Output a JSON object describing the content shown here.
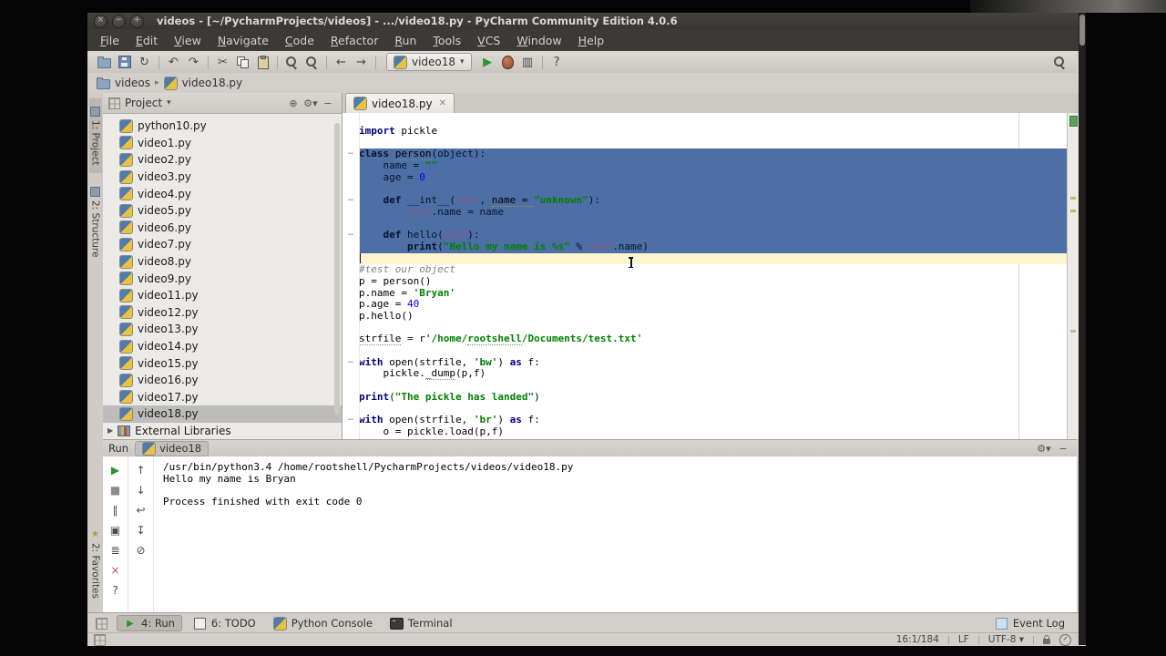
{
  "titlebar": {
    "title": "videos - [~/PycharmProjects/videos] - .../video18.py - PyCharm Community Edition 4.0.6",
    "buttons": [
      {
        "name": "close-button",
        "glyph": "×"
      },
      {
        "name": "minimize-button",
        "glyph": "−"
      },
      {
        "name": "maximize-button",
        "glyph": "+"
      }
    ]
  },
  "menubar": {
    "items": [
      "File",
      "Edit",
      "View",
      "Navigate",
      "Code",
      "Refactor",
      "Run",
      "Tools",
      "VCS",
      "Window",
      "Help"
    ]
  },
  "toolbar": {
    "left_icons": [
      {
        "name": "open-icon",
        "shape": "folder"
      },
      {
        "name": "save-all-icon",
        "shape": "floppy"
      },
      {
        "name": "synchronize-icon",
        "glyph": "↻"
      },
      {
        "sep": true
      },
      {
        "name": "undo-icon",
        "glyph": "↶"
      },
      {
        "name": "redo-icon",
        "glyph": "↷"
      },
      {
        "sep": true
      },
      {
        "name": "cut-icon",
        "glyph": "✂"
      },
      {
        "name": "copy-icon",
        "shape": "copy"
      },
      {
        "name": "paste-icon",
        "shape": "paste"
      },
      {
        "sep": true
      },
      {
        "name": "find-icon",
        "shape": "mag"
      },
      {
        "name": "replace-icon",
        "shape": "mag"
      },
      {
        "sep": true
      },
      {
        "name": "back-icon",
        "glyph": "←"
      },
      {
        "name": "forward-icon",
        "glyph": "→"
      },
      {
        "sep": true
      }
    ],
    "run_config": {
      "label": "video18"
    },
    "right_icons": [
      {
        "name": "run-icon",
        "glyph": "▶",
        "tint": "green"
      },
      {
        "name": "debug-icon",
        "shape": "bug"
      },
      {
        "name": "coverage-icon",
        "glyph": "▥"
      },
      {
        "sep": true
      },
      {
        "name": "help-icon",
        "glyph": "?"
      }
    ]
  },
  "navbar": {
    "crumbs": [
      {
        "label": "videos",
        "icon": "folder"
      },
      {
        "label": "video18.py",
        "icon": "python"
      }
    ]
  },
  "tool_strip": {
    "top": [
      {
        "label": "1: Project",
        "active": true
      },
      {
        "label": "2: Structure",
        "active": false
      }
    ],
    "bottom": [
      {
        "label": "2: Favorites",
        "active": false
      }
    ]
  },
  "project": {
    "header": {
      "title": "Project",
      "icons": [
        {
          "name": "locate-icon",
          "glyph": "⊕"
        },
        {
          "name": "settings-gear-icon",
          "glyph": "⚙▾"
        },
        {
          "name": "hide-panel-icon",
          "glyph": "−"
        }
      ]
    },
    "files": [
      "python10.py",
      "video1.py",
      "video2.py",
      "video3.py",
      "video4.py",
      "video5.py",
      "video6.py",
      "video7.py",
      "video8.py",
      "video9.py",
      "video11.py",
      "video12.py",
      "video13.py",
      "video14.py",
      "video15.py",
      "video16.py",
      "video17.py",
      "video18.py"
    ],
    "selected": "video18.py",
    "external_libraries": "External Libraries"
  },
  "editor": {
    "tab": {
      "label": "video18.py"
    },
    "lines": [
      {
        "hl": "",
        "fold": "",
        "seg": [
          [
            "import",
            "k"
          ],
          [
            " pickle",
            "p"
          ]
        ]
      },
      {
        "hl": "",
        "fold": "",
        "seg": []
      },
      {
        "hl": "sel",
        "fold": "−",
        "seg": [
          [
            "class",
            "k"
          ],
          [
            " ",
            "p"
          ],
          [
            "person",
            "u"
          ],
          [
            "(object):",
            "p"
          ]
        ]
      },
      {
        "hl": "sel",
        "fold": "",
        "seg": [
          [
            "    name = ",
            "p"
          ],
          [
            "\"\"",
            "s"
          ]
        ]
      },
      {
        "hl": "sel",
        "fold": "",
        "seg": [
          [
            "    age = ",
            "p"
          ],
          [
            "0",
            "n"
          ]
        ]
      },
      {
        "hl": "sel",
        "fold": "",
        "seg": []
      },
      {
        "hl": "sel",
        "fold": "−",
        "seg": [
          [
            "    ",
            "p"
          ],
          [
            "def",
            "k"
          ],
          [
            " __int__(",
            "p"
          ],
          [
            "self",
            "f"
          ],
          [
            ", ",
            "p"
          ],
          [
            "name = ",
            "w"
          ],
          [
            "\"unknown\"",
            "s"
          ],
          [
            "):",
            "p"
          ]
        ]
      },
      {
        "hl": "sel",
        "fold": "",
        "seg": [
          [
            "        ",
            "p"
          ],
          [
            "self",
            "f"
          ],
          [
            ".name = name",
            "p"
          ]
        ]
      },
      {
        "hl": "sel",
        "fold": "",
        "seg": []
      },
      {
        "hl": "sel",
        "fold": "−",
        "seg": [
          [
            "    ",
            "p"
          ],
          [
            "def",
            "k"
          ],
          [
            " hello(",
            "p"
          ],
          [
            "self",
            "f"
          ],
          [
            "):",
            "p"
          ]
        ]
      },
      {
        "hl": "sel",
        "fold": "",
        "seg": [
          [
            "        ",
            "p"
          ],
          [
            "print",
            "k"
          ],
          [
            "(",
            "p"
          ],
          [
            "\"Hello my name is %s\"",
            "s"
          ],
          [
            " % ",
            "p"
          ],
          [
            "self",
            "f"
          ],
          [
            ".name)",
            "p"
          ]
        ]
      },
      {
        "hl": "cur",
        "fold": "",
        "seg": []
      },
      {
        "hl": "",
        "fold": "",
        "seg": [
          [
            "#test our object",
            "c"
          ]
        ]
      },
      {
        "hl": "",
        "fold": "",
        "seg": [
          [
            "p = person()",
            "p"
          ]
        ]
      },
      {
        "hl": "",
        "fold": "",
        "seg": [
          [
            "p.name = ",
            "p"
          ],
          [
            "'Bryan'",
            "s"
          ]
        ]
      },
      {
        "hl": "",
        "fold": "",
        "seg": [
          [
            "p.age = ",
            "p"
          ],
          [
            "40",
            "n"
          ]
        ]
      },
      {
        "hl": "",
        "fold": "",
        "seg": [
          [
            "p.hello()",
            "p"
          ]
        ]
      },
      {
        "hl": "",
        "fold": "",
        "seg": []
      },
      {
        "hl": "",
        "fold": "",
        "seg": [
          [
            "strfile",
            "u"
          ],
          [
            " = r",
            "p"
          ],
          [
            "'/home/",
            "s"
          ],
          [
            "rootshell",
            "su"
          ],
          [
            "/Documents/test.txt'",
            "s"
          ]
        ]
      },
      {
        "hl": "",
        "fold": "",
        "seg": []
      },
      {
        "hl": "",
        "fold": "−",
        "seg": [
          [
            "with",
            "k"
          ],
          [
            " open(strfile, ",
            "p"
          ],
          [
            "'bw'",
            "s"
          ],
          [
            ") ",
            "p"
          ],
          [
            "as",
            "k"
          ],
          [
            " f:",
            "p"
          ]
        ]
      },
      {
        "hl": "",
        "fold": "",
        "seg": [
          [
            "    pickle.",
            "p"
          ],
          [
            "_dump",
            "u"
          ],
          [
            "(p,f)",
            "p"
          ]
        ]
      },
      {
        "hl": "",
        "fold": "",
        "seg": []
      },
      {
        "hl": "",
        "fold": "",
        "seg": [
          [
            "print",
            "k"
          ],
          [
            "(",
            "p"
          ],
          [
            "\"The pickle has landed\"",
            "s"
          ],
          [
            ")",
            "p"
          ]
        ]
      },
      {
        "hl": "",
        "fold": "",
        "seg": []
      },
      {
        "hl": "",
        "fold": "−",
        "seg": [
          [
            "with",
            "k"
          ],
          [
            " open(strfile, ",
            "p"
          ],
          [
            "'br'",
            "s"
          ],
          [
            ") ",
            "p"
          ],
          [
            "as",
            "k"
          ],
          [
            " f:",
            "p"
          ]
        ]
      },
      {
        "hl": "",
        "fold": "",
        "seg": [
          [
            "    o = pickle.load(p,f)",
            "p"
          ]
        ]
      }
    ]
  },
  "run_panel": {
    "title": "Run",
    "tab": {
      "label": "video18"
    },
    "header_icons": [
      {
        "name": "settings-gear-icon",
        "glyph": "⚙▾"
      },
      {
        "name": "minimize-icon",
        "glyph": "−"
      }
    ],
    "toolbar_col1": [
      {
        "name": "rerun-icon",
        "glyph": "▶",
        "tint": "green"
      },
      {
        "name": "stop-icon",
        "glyph": "■",
        "tint": "muted"
      },
      {
        "name": "pause-output-icon",
        "glyph": "∥"
      },
      {
        "name": "restore-layout-icon",
        "glyph": "▣"
      },
      {
        "name": "print-icon",
        "glyph": "≣"
      },
      {
        "name": "close-icon",
        "glyph": "×",
        "tint": "red"
      },
      {
        "name": "help-icon",
        "glyph": "?"
      }
    ],
    "toolbar_col2": [
      {
        "name": "up-stack-trace-icon",
        "glyph": "↑"
      },
      {
        "name": "down-stack-trace-icon",
        "glyph": "↓"
      },
      {
        "name": "soft-wrap-icon",
        "glyph": "↩"
      },
      {
        "name": "scroll-to-end-icon",
        "glyph": "↧"
      },
      {
        "name": "clear-all-icon",
        "glyph": "⊘"
      }
    ],
    "console": [
      "/usr/bin/python3.4 /home/rootshell/PycharmProjects/videos/video18.py",
      "Hello my name is Bryan",
      "",
      "Process finished with exit code 0"
    ]
  },
  "bottombar": {
    "left": [
      {
        "label": "4: Run",
        "icon": "run",
        "active": true
      },
      {
        "label": "6: TODO",
        "icon": "todo",
        "active": false
      },
      {
        "label": "Python Console",
        "icon": "python",
        "active": false
      },
      {
        "label": "Terminal",
        "icon": "terminal",
        "active": false
      }
    ],
    "right": [
      {
        "label": "Event Log",
        "icon": "log",
        "active": false
      }
    ]
  },
  "statusbar": {
    "position": "16:1/184",
    "line_ending": "LF",
    "encoding": "UTF-8"
  }
}
